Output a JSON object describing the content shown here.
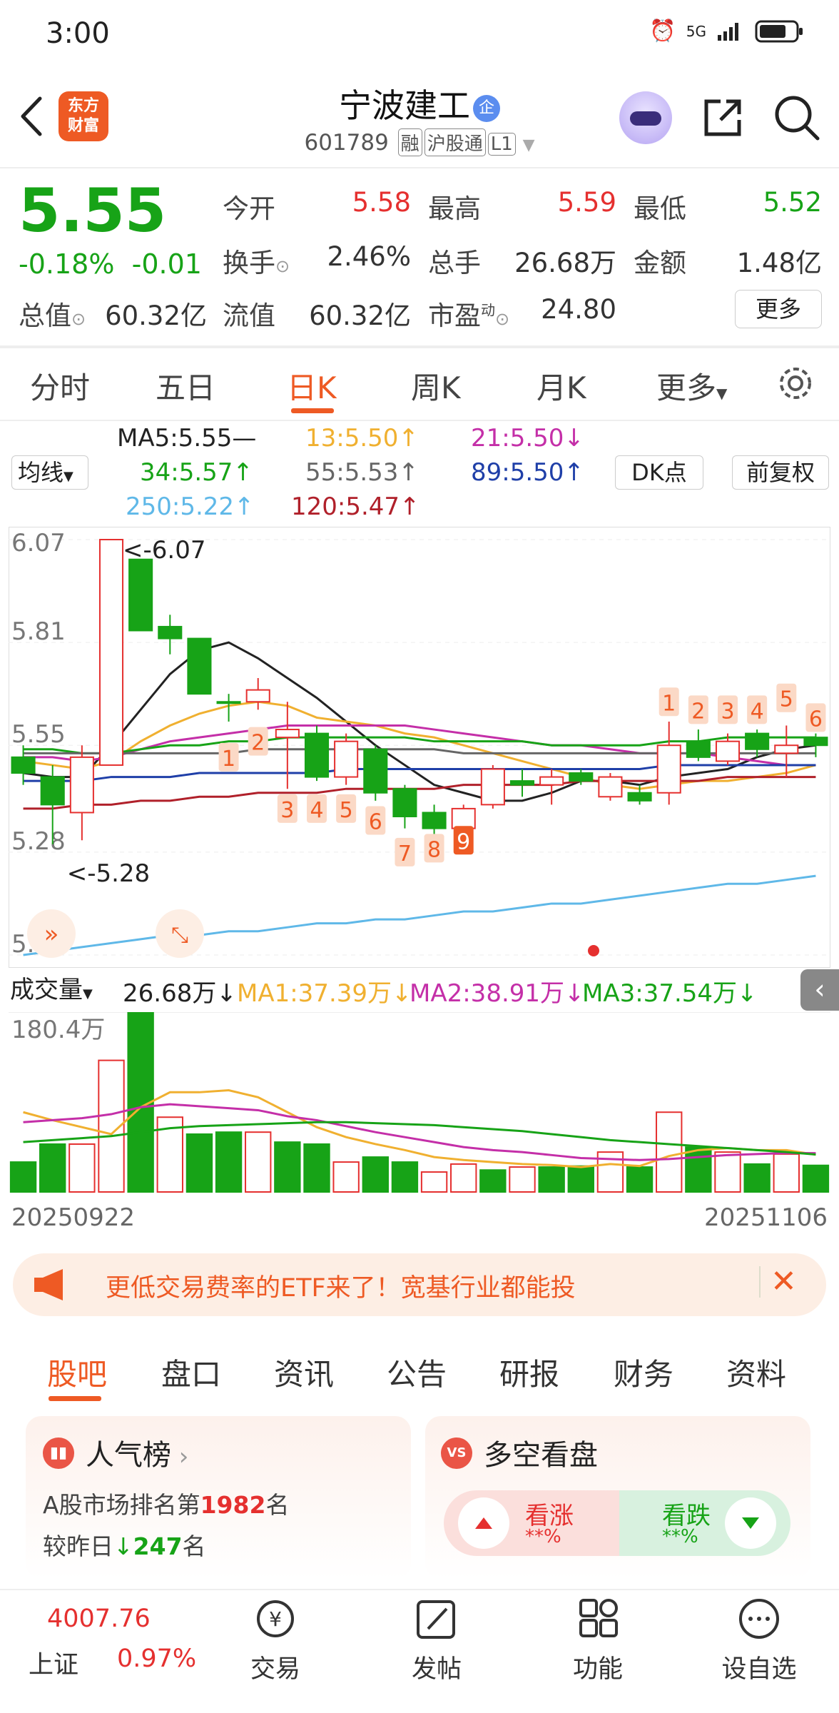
{
  "status": {
    "time": "3:00",
    "network": "5G"
  },
  "header": {
    "logo_text": "东方财富",
    "name": "宁波建工",
    "badge": "企",
    "code": "601789",
    "tags": [
      "融",
      "沪股通",
      "L1"
    ]
  },
  "quote": {
    "price": "5.55",
    "change_pct": "-0.18%",
    "change": "-0.01",
    "labels": {
      "open": "今开",
      "high": "最高",
      "low": "最低",
      "turnover": "换手",
      "volume": "总手",
      "amount": "金额",
      "mktcap": "总值",
      "float": "流值",
      "pe": "市盈",
      "pe_sup": "动"
    },
    "open": "5.58",
    "high": "5.59",
    "low": "5.52",
    "turnover": "2.46%",
    "volume": "26.68万",
    "amount": "1.48亿",
    "mktcap": "60.32亿",
    "float": "60.32亿",
    "pe": "24.80",
    "more": "更多"
  },
  "period_tabs": [
    "分时",
    "五日",
    "日K",
    "周K",
    "月K",
    "更多"
  ],
  "ma_legend": {
    "selector": "均线",
    "items": [
      {
        "text": "MA5:5.55—",
        "color": "#222222"
      },
      {
        "text": "13:5.50↑",
        "color": "#f0b030"
      },
      {
        "text": "21:5.50↓",
        "color": "#c42fa8"
      },
      {
        "text": "34:5.57↑",
        "color": "#17a317"
      },
      {
        "text": "55:5.53↑",
        "color": "#666666"
      },
      {
        "text": "89:5.50↑",
        "color": "#1f3fa8"
      },
      {
        "text": "250:5.22↑",
        "color": "#5fb8e8"
      },
      {
        "text": "120:5.47↑",
        "color": "#b0202a"
      }
    ],
    "dk": "DK点",
    "adjust": "前复权"
  },
  "chart_data": [
    {
      "type": "candlestick",
      "y_ticks": [
        "6.07",
        "5.81",
        "5.55",
        "5.28",
        "5.02"
      ],
      "ylim": [
        5.02,
        6.07
      ],
      "annotations": {
        "max": "<-6.07",
        "min": "<-5.28"
      },
      "candles": [
        {
          "o": 5.52,
          "c": 5.48,
          "h": 5.55,
          "l": 5.45,
          "up": false
        },
        {
          "o": 5.47,
          "c": 5.4,
          "h": 5.5,
          "l": 5.3,
          "up": false
        },
        {
          "o": 5.38,
          "c": 5.52,
          "h": 5.55,
          "l": 5.31,
          "up": true
        },
        {
          "o": 5.5,
          "c": 6.07,
          "h": 6.07,
          "l": 5.5,
          "up": true
        },
        {
          "o": 6.02,
          "c": 5.84,
          "h": 6.02,
          "l": 5.84,
          "up": false
        },
        {
          "o": 5.85,
          "c": 5.82,
          "h": 5.88,
          "l": 5.78,
          "up": false
        },
        {
          "o": 5.82,
          "c": 5.68,
          "h": 5.82,
          "l": 5.68,
          "up": false
        },
        {
          "o": 5.66,
          "c": 5.66,
          "h": 5.68,
          "l": 5.61,
          "up": false
        },
        {
          "o": 5.66,
          "c": 5.69,
          "h": 5.72,
          "l": 5.64,
          "up": true
        },
        {
          "o": 5.59,
          "c": 5.57,
          "h": 5.66,
          "l": 5.44,
          "up": true
        },
        {
          "o": 5.58,
          "c": 5.47,
          "h": 5.6,
          "l": 5.46,
          "up": false
        },
        {
          "o": 5.47,
          "c": 5.56,
          "h": 5.58,
          "l": 5.45,
          "up": true
        },
        {
          "o": 5.54,
          "c": 5.43,
          "h": 5.55,
          "l": 5.41,
          "up": false
        },
        {
          "o": 5.44,
          "c": 5.37,
          "h": 5.45,
          "l": 5.34,
          "up": false
        },
        {
          "o": 5.38,
          "c": 5.34,
          "h": 5.4,
          "l": 5.3,
          "up": false
        },
        {
          "o": 5.34,
          "c": 5.39,
          "h": 5.4,
          "l": 5.33,
          "up": true
        },
        {
          "o": 5.4,
          "c": 5.49,
          "h": 5.5,
          "l": 5.39,
          "up": true
        },
        {
          "o": 5.46,
          "c": 5.45,
          "h": 5.49,
          "l": 5.42,
          "up": false
        },
        {
          "o": 5.45,
          "c": 5.47,
          "h": 5.49,
          "l": 5.4,
          "up": true
        },
        {
          "o": 5.48,
          "c": 5.46,
          "h": 5.49,
          "l": 5.45,
          "up": false
        },
        {
          "o": 5.42,
          "c": 5.47,
          "h": 5.48,
          "l": 5.41,
          "up": true
        },
        {
          "o": 5.43,
          "c": 5.41,
          "h": 5.45,
          "l": 5.4,
          "up": false
        },
        {
          "o": 5.43,
          "c": 5.55,
          "h": 5.61,
          "l": 5.4,
          "up": true
        },
        {
          "o": 5.56,
          "c": 5.52,
          "h": 5.59,
          "l": 5.51,
          "up": false
        },
        {
          "o": 5.51,
          "c": 5.56,
          "h": 5.58,
          "l": 5.5,
          "up": true
        },
        {
          "o": 5.58,
          "c": 5.54,
          "h": 5.59,
          "l": 5.52,
          "up": false
        },
        {
          "o": 5.55,
          "c": 5.53,
          "h": 5.6,
          "l": 5.47,
          "up": true
        },
        {
          "o": 5.57,
          "c": 5.55,
          "h": 5.58,
          "l": 5.52,
          "up": false
        }
      ],
      "markers": [
        {
          "label": "1",
          "idx": 7,
          "y": 5.52
        },
        {
          "label": "2",
          "idx": 8,
          "y": 5.56
        },
        {
          "label": "3",
          "idx": 9,
          "y": 5.39
        },
        {
          "label": "4",
          "idx": 10,
          "y": 5.39
        },
        {
          "label": "5",
          "idx": 11,
          "y": 5.39
        },
        {
          "label": "6",
          "idx": 12,
          "y": 5.36
        },
        {
          "label": "7",
          "idx": 13,
          "y": 5.28
        },
        {
          "label": "8",
          "idx": 14,
          "y": 5.29
        },
        {
          "label": "9",
          "idx": 15,
          "y": 5.31
        },
        {
          "label": "1",
          "idx": 22,
          "y": 5.66
        },
        {
          "label": "2",
          "idx": 23,
          "y": 5.64
        },
        {
          "label": "3",
          "idx": 24,
          "y": 5.64
        },
        {
          "label": "4",
          "idx": 25,
          "y": 5.64
        },
        {
          "label": "5",
          "idx": 26,
          "y": 5.67
        },
        {
          "label": "6",
          "idx": 27,
          "y": 5.62
        }
      ],
      "ma_lines": [
        {
          "name": "MA5",
          "color": "#222222",
          "values": [
            5.48,
            5.47,
            5.47,
            5.55,
            5.64,
            5.73,
            5.79,
            5.81,
            5.77,
            5.72,
            5.67,
            5.61,
            5.55,
            5.5,
            5.45,
            5.43,
            5.41,
            5.41,
            5.43,
            5.46,
            5.46,
            5.45,
            5.47,
            5.48,
            5.49,
            5.52,
            5.54,
            5.55
          ]
        },
        {
          "name": "13",
          "color": "#f0b030",
          "values": [
            5.51,
            5.5,
            5.49,
            5.51,
            5.56,
            5.6,
            5.63,
            5.65,
            5.66,
            5.65,
            5.62,
            5.61,
            5.6,
            5.58,
            5.57,
            5.55,
            5.53,
            5.51,
            5.49,
            5.47,
            5.45,
            5.44,
            5.45,
            5.46,
            5.46,
            5.47,
            5.48,
            5.5
          ]
        },
        {
          "name": "21",
          "color": "#c42fa8",
          "values": [
            5.52,
            5.52,
            5.51,
            5.52,
            5.54,
            5.56,
            5.57,
            5.58,
            5.59,
            5.6,
            5.6,
            5.6,
            5.6,
            5.6,
            5.59,
            5.58,
            5.57,
            5.56,
            5.55,
            5.55,
            5.54,
            5.53,
            5.53,
            5.53,
            5.52,
            5.51,
            5.5,
            5.5
          ]
        },
        {
          "name": "34",
          "color": "#17a317",
          "values": [
            5.54,
            5.54,
            5.53,
            5.53,
            5.54,
            5.55,
            5.55,
            5.56,
            5.56,
            5.57,
            5.57,
            5.57,
            5.57,
            5.57,
            5.56,
            5.56,
            5.56,
            5.56,
            5.55,
            5.55,
            5.55,
            5.55,
            5.56,
            5.56,
            5.57,
            5.57,
            5.57,
            5.57
          ]
        },
        {
          "name": "55",
          "color": "#666666",
          "values": [
            5.53,
            5.53,
            5.53,
            5.53,
            5.53,
            5.53,
            5.53,
            5.53,
            5.54,
            5.54,
            5.54,
            5.54,
            5.54,
            5.54,
            5.54,
            5.53,
            5.53,
            5.53,
            5.53,
            5.53,
            5.53,
            5.53,
            5.53,
            5.53,
            5.53,
            5.53,
            5.53,
            5.53
          ]
        },
        {
          "name": "89",
          "color": "#1f3fa8",
          "values": [
            5.46,
            5.46,
            5.46,
            5.47,
            5.47,
            5.47,
            5.48,
            5.48,
            5.48,
            5.48,
            5.48,
            5.49,
            5.49,
            5.49,
            5.49,
            5.49,
            5.49,
            5.49,
            5.49,
            5.49,
            5.49,
            5.49,
            5.5,
            5.5,
            5.5,
            5.5,
            5.5,
            5.5
          ]
        },
        {
          "name": "120",
          "color": "#b0202a",
          "values": [
            5.39,
            5.39,
            5.4,
            5.4,
            5.41,
            5.41,
            5.42,
            5.42,
            5.43,
            5.43,
            5.43,
            5.44,
            5.44,
            5.44,
            5.44,
            5.45,
            5.45,
            5.45,
            5.45,
            5.46,
            5.46,
            5.46,
            5.46,
            5.46,
            5.47,
            5.47,
            5.47,
            5.47
          ]
        },
        {
          "name": "250",
          "color": "#5fb8e8",
          "values": [
            5.02,
            5.03,
            5.04,
            5.05,
            5.06,
            5.07,
            5.07,
            5.08,
            5.08,
            5.09,
            5.1,
            5.1,
            5.11,
            5.11,
            5.12,
            5.13,
            5.13,
            5.14,
            5.15,
            5.15,
            5.16,
            5.17,
            5.18,
            5.19,
            5.2,
            5.2,
            5.21,
            5.22
          ]
        }
      ]
    },
    {
      "type": "bar",
      "name": "成交量",
      "y_max_label": "180.4万",
      "ylim": [
        0,
        180.4
      ],
      "unit": "万",
      "values": [
        30,
        48,
        48,
        132,
        180.4,
        75,
        58,
        60,
        60,
        50,
        48,
        30,
        35,
        30,
        20,
        28,
        22,
        25,
        25,
        26,
        40,
        25,
        80,
        45,
        40,
        28,
        38,
        26.68
      ],
      "up": [
        false,
        false,
        true,
        true,
        false,
        true,
        false,
        false,
        true,
        false,
        false,
        true,
        false,
        false,
        true,
        true,
        false,
        true,
        false,
        false,
        true,
        false,
        true,
        false,
        true,
        false,
        true,
        false
      ],
      "ma_lines": [
        {
          "name": "MA1",
          "color": "#f0b030",
          "values": [
            80,
            72,
            65,
            58,
            85,
            100,
            100,
            102,
            95,
            80,
            65,
            55,
            48,
            42,
            35,
            32,
            30,
            28,
            27,
            25,
            28,
            26,
            36,
            42,
            44,
            42,
            42,
            37.39
          ]
        },
        {
          "name": "MA2",
          "color": "#c42fa8",
          "values": [
            70,
            72,
            74,
            78,
            85,
            88,
            86,
            84,
            82,
            76,
            72,
            66,
            60,
            55,
            50,
            45,
            42,
            40,
            37,
            34,
            33,
            32,
            33,
            35,
            37,
            38,
            39,
            38.91
          ]
        },
        {
          "name": "MA3",
          "color": "#17a317",
          "values": [
            50,
            52,
            54,
            56,
            60,
            64,
            66,
            67,
            68,
            69,
            70,
            70,
            69,
            68,
            67,
            65,
            63,
            61,
            58,
            55,
            52,
            50,
            48,
            46,
            44,
            42,
            40,
            37.54
          ]
        }
      ]
    }
  ],
  "volume_legend": {
    "selector": "成交量",
    "current": "26.68万↓",
    "ma1": "MA1:37.39万↓",
    "ma2": "MA2:38.91万↓",
    "ma3": "MA3:37.54万↓"
  },
  "dates": {
    "start": "20250922",
    "end": "20251106"
  },
  "promo": {
    "text": "更低交易费率的ETF来了！宽基行业都能投"
  },
  "bottom_tabs": [
    "股吧",
    "盘口",
    "资讯",
    "公告",
    "研报",
    "财务",
    "资料"
  ],
  "popularity": {
    "title": "人气榜",
    "rank_prefix": "A股市场排名第",
    "rank": "1982",
    "rank_suffix": "名",
    "change_prefix": "较昨日",
    "change": "247",
    "change_suffix": "名"
  },
  "sentiment": {
    "title": "多空看盘",
    "bull": "看涨",
    "bull_pct": "**%",
    "bear": "看跌",
    "bear_pct": "**%"
  },
  "nav": {
    "index_value": "4007.76",
    "index_name": "上证",
    "index_change": "0.97%",
    "items": [
      "交易",
      "发帖",
      "功能",
      "设自选"
    ]
  },
  "colors": {
    "up": "#e5302f",
    "down": "#17a317",
    "accent": "#ee5a24"
  }
}
